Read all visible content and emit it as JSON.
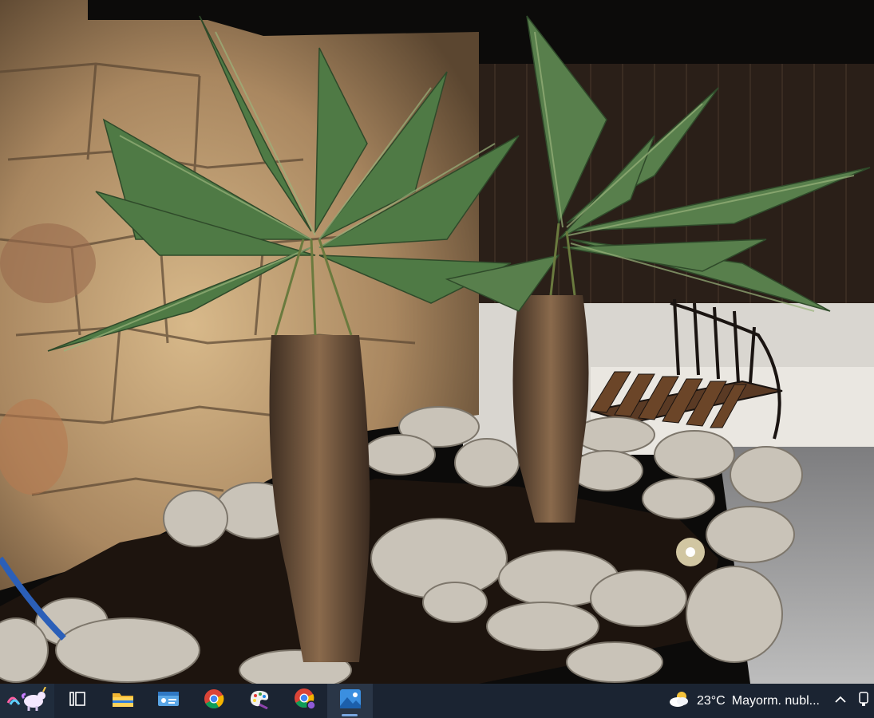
{
  "window": {
    "content": "night photo of two palm trees in a stone-walled garden bed with a wooden bench"
  },
  "taskbar": {
    "widgets_icon": "unicorn-widget-icon",
    "apps": [
      {
        "name": "task-view",
        "icon": "task-view-icon",
        "active": false
      },
      {
        "name": "file-explorer",
        "icon": "folder-icon",
        "active": false
      },
      {
        "name": "control-panel",
        "icon": "id-card-icon",
        "active": false
      },
      {
        "name": "chrome",
        "icon": "chrome-icon",
        "active": false
      },
      {
        "name": "paint",
        "icon": "paint-palette-icon",
        "active": false
      },
      {
        "name": "chrome-profile",
        "icon": "chrome-profile-icon",
        "active": false
      },
      {
        "name": "photos",
        "icon": "photos-icon",
        "active": true
      }
    ],
    "weather": {
      "icon": "partly-cloudy-icon",
      "temperature": "23°C",
      "condition": "Mayorm. nubl..."
    },
    "tray": {
      "chevron": "chevron-up-icon",
      "device": "device-icon"
    }
  },
  "colors": {
    "taskbar": "#1b2432",
    "accent": "#7aa7e0"
  }
}
